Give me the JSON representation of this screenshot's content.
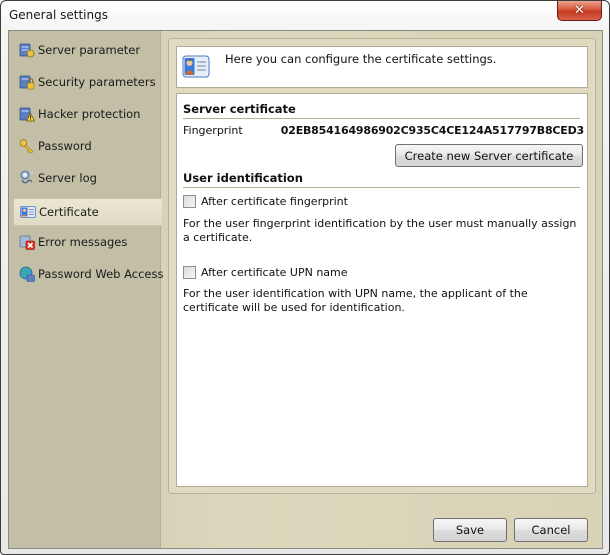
{
  "window": {
    "title": "General settings",
    "close_glyph": "✕"
  },
  "sidebar": {
    "items": [
      {
        "label": "Server parameter",
        "icon": "server-parameter-icon",
        "selected": false
      },
      {
        "label": "Security parameters",
        "icon": "security-lock-icon",
        "selected": false
      },
      {
        "label": "Hacker protection",
        "icon": "warning-server-icon",
        "selected": false
      },
      {
        "label": "Password",
        "icon": "key-icon",
        "selected": false
      },
      {
        "label": "Server log",
        "icon": "server-log-icon",
        "selected": false
      },
      {
        "label": "Certificate",
        "icon": "certificate-card-icon",
        "selected": true
      },
      {
        "label": "Error messages",
        "icon": "error-icon",
        "selected": false
      },
      {
        "label": "Password Web Access",
        "icon": "globe-icon",
        "selected": false
      }
    ]
  },
  "header": {
    "icon": "certificate-card-icon",
    "text": "Here you can configure the certificate settings."
  },
  "server_certificate": {
    "title": "Server certificate",
    "fingerprint_label": "Fingerprint",
    "fingerprint_value": "02EB854164986902C935C4CE124A517797B8CED3",
    "create_button": "Create new Server certificate"
  },
  "user_identification": {
    "title": "User identification",
    "options": [
      {
        "label": "After certificate fingerprint",
        "checked": false,
        "description": "For the user fingerprint identification by the user must manually assign a certificate."
      },
      {
        "label": "After certificate UPN name",
        "checked": false,
        "description": "For the user identification with UPN name, the applicant of the certificate will be used for identification."
      }
    ]
  },
  "footer": {
    "save_label": "Save",
    "cancel_label": "Cancel"
  }
}
